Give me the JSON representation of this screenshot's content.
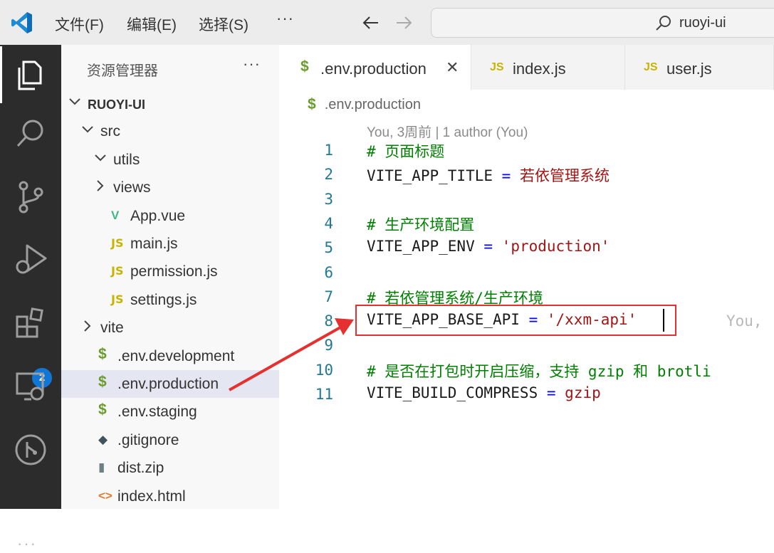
{
  "titlebar": {
    "menu": [
      "文件(F)",
      "编辑(E)",
      "选择(S)"
    ],
    "more": "···",
    "search_text": "ruoyi-ui"
  },
  "activity_bar": {
    "items": [
      "explorer-icon",
      "search-icon",
      "source-control-icon",
      "run-debug-icon",
      "extensions-icon",
      "remote-explorer-icon",
      "git-graph-icon"
    ],
    "extensions_badge": "2",
    "more": "···"
  },
  "sidebar": {
    "title": "资源管理器",
    "more": "···",
    "tree": [
      {
        "label": "RUOYI-UI",
        "depth": 0,
        "type": "folder-open",
        "bold": true
      },
      {
        "label": "src",
        "depth": 1,
        "type": "folder-open"
      },
      {
        "label": "utils",
        "depth": 2,
        "type": "folder-open"
      },
      {
        "label": "views",
        "depth": 2,
        "type": "folder-closed"
      },
      {
        "label": "App.vue",
        "depth": 2,
        "type": "vue"
      },
      {
        "label": "main.js",
        "depth": 2,
        "type": "js"
      },
      {
        "label": "permission.js",
        "depth": 2,
        "type": "js"
      },
      {
        "label": "settings.js",
        "depth": 2,
        "type": "js"
      },
      {
        "label": "vite",
        "depth": 1,
        "type": "folder-closed"
      },
      {
        "label": ".env.development",
        "depth": 1,
        "type": "env"
      },
      {
        "label": ".env.production",
        "depth": 1,
        "type": "env",
        "selected": true
      },
      {
        "label": ".env.staging",
        "depth": 1,
        "type": "env"
      },
      {
        "label": ".gitignore",
        "depth": 1,
        "type": "git"
      },
      {
        "label": "dist.zip",
        "depth": 1,
        "type": "zip"
      },
      {
        "label": "index.html",
        "depth": 1,
        "type": "html"
      }
    ]
  },
  "tabs": [
    {
      "label": ".env.production",
      "icon": "$",
      "active": true,
      "close": "✕"
    },
    {
      "label": "index.js",
      "icon": "JS",
      "active": false
    },
    {
      "label": "user.js",
      "icon": "JS",
      "active": false
    }
  ],
  "editor": {
    "breadcrumb": ".env.production",
    "breadcrumb_icon": "$",
    "blame": "You, 3周前 | 1 author (You)",
    "lines": [
      {
        "n": "1",
        "segments": [
          {
            "t": "# 页面标题",
            "c": "comment"
          }
        ]
      },
      {
        "n": "2",
        "segments": [
          {
            "t": "VITE_APP_TITLE ",
            "c": "plain"
          },
          {
            "t": "=",
            "c": "op"
          },
          {
            "t": " 若依管理系统",
            "c": "str"
          }
        ]
      },
      {
        "n": "3",
        "segments": []
      },
      {
        "n": "4",
        "segments": [
          {
            "t": "# 生产环境配置",
            "c": "comment"
          }
        ]
      },
      {
        "n": "5",
        "segments": [
          {
            "t": "VITE_APP_ENV ",
            "c": "plain"
          },
          {
            "t": "=",
            "c": "op"
          },
          {
            "t": " 'production'",
            "c": "str"
          }
        ]
      },
      {
        "n": "6",
        "segments": []
      },
      {
        "n": "7",
        "segments": [
          {
            "t": "# 若依管理系统/生产环境",
            "c": "comment"
          }
        ]
      },
      {
        "n": "8",
        "segments": [
          {
            "t": "VITE_APP_BASE_API ",
            "c": "plain"
          },
          {
            "t": "=",
            "c": "op"
          },
          {
            "t": " '/xxm-api'",
            "c": "str"
          }
        ],
        "ghost": "You,"
      },
      {
        "n": "9",
        "segments": []
      },
      {
        "n": "10",
        "segments": [
          {
            "t": "# 是否在打包时开启压缩，支持 gzip 和 brotli",
            "c": "comment"
          }
        ]
      },
      {
        "n": "11",
        "segments": [
          {
            "t": "VITE_BUILD_COMPRESS ",
            "c": "plain"
          },
          {
            "t": "=",
            "c": "op"
          },
          {
            "t": " gzip",
            "c": "str"
          }
        ]
      }
    ]
  },
  "colors": {
    "annotation_red": "#e53030",
    "comment": "#008000",
    "string": "#a31515",
    "operator": "#0000ff",
    "line_number": "#237893"
  }
}
